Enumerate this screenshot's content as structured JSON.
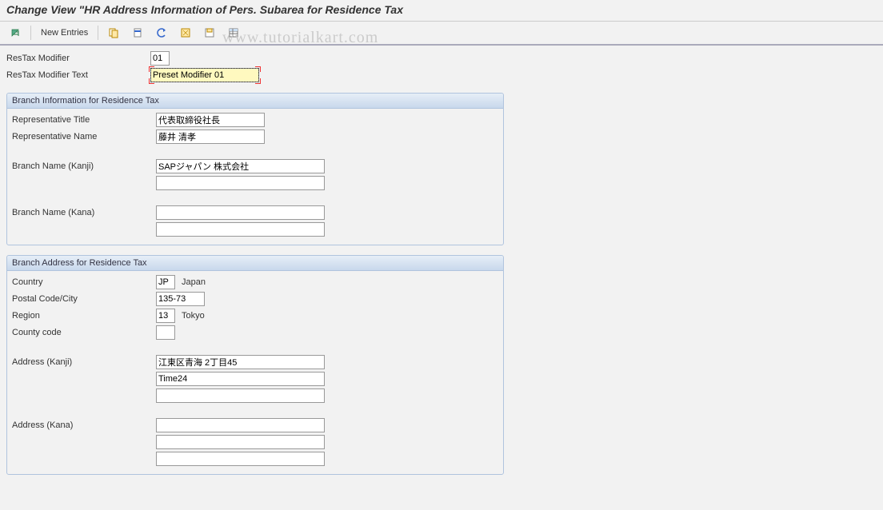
{
  "page_title": "Change View \"HR Address Information of Pers. Subarea for Residence Tax",
  "toolbar": {
    "new_entries_label": "New Entries"
  },
  "header": {
    "restax_modifier_label": "ResTax Modifier",
    "restax_modifier_value": "01",
    "restax_modifier_text_label": "ResTax Modifier Text",
    "restax_modifier_text_value": "Preset Modifier 01"
  },
  "branch_info": {
    "title": "Branch Information for Residence Tax",
    "rep_title_label": "Representative Title",
    "rep_title_value": "代表取締役社長",
    "rep_name_label": "Representative Name",
    "rep_name_value": "藤井 清孝",
    "branch_kanji_label": "Branch Name (Kanji)",
    "branch_kanji_value": "SAPジャパン 株式会社",
    "branch_kanji_value2": "",
    "branch_kana_label": "Branch Name (Kana)",
    "branch_kana_value": "",
    "branch_kana_value2": ""
  },
  "branch_addr": {
    "title": "Branch Address for Residence Tax",
    "country_label": "Country",
    "country_value": "JP",
    "country_text": "Japan",
    "postal_label": "Postal Code/City",
    "postal_value": "135-73",
    "region_label": "Region",
    "region_value": "13",
    "region_text": "Tokyo",
    "county_label": "County code",
    "county_value": "",
    "addr_kanji_label": "Address (Kanji)",
    "addr_kanji_1": "江東区青海 2丁目45",
    "addr_kanji_2": "Time24",
    "addr_kanji_3": "",
    "addr_kana_label": "Address (Kana)",
    "addr_kana_1": "",
    "addr_kana_2": "",
    "addr_kana_3": ""
  },
  "watermark": "www.tutorialkart.com"
}
